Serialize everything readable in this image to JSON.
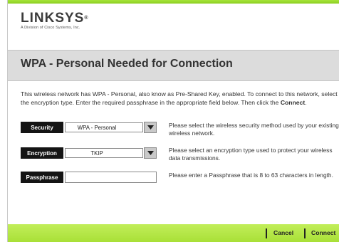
{
  "brand": {
    "name": "LINKSYS",
    "registered_mark": "®",
    "tagline": "A Division of Cisco Systems, Inc."
  },
  "page": {
    "title": "WPA - Personal Needed for Connection",
    "intro": "This wireless network has WPA - Personal, also know as Pre-Shared Key, enabled. To connect to this network, select the encryption type. Enter the required passphrase in the appropriate field below. Then click the ",
    "intro_bold": "Connect",
    "intro_end": "."
  },
  "fields": {
    "security": {
      "label": "Security",
      "value": "WPA - Personal",
      "help": "Please select the wireless security method used by your existing wireless network."
    },
    "encryption": {
      "label": "Encryption",
      "value": "TKIP",
      "help": "Please select an encryption type used to protect your wireless data transmissions."
    },
    "passphrase": {
      "label": "Passphrase",
      "value": "",
      "help": "Please enter a Passphrase that is 8 to 63 characters in length."
    }
  },
  "footer": {
    "cancel_label": "Cancel",
    "connect_label": "Connect"
  },
  "colors": {
    "accent_green": "#a9e037",
    "label_black": "#141414",
    "title_band": "#dcdcdc"
  }
}
